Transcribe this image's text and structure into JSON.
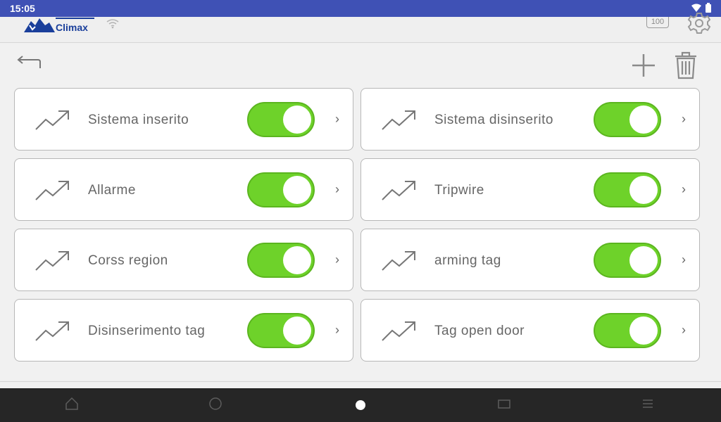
{
  "status": {
    "time": "15:05"
  },
  "app": {
    "brand": "Climax",
    "battery_label": "100"
  },
  "cards": [
    {
      "label": "Sistema inserito",
      "enabled": true
    },
    {
      "label": "Sistema disinserito",
      "enabled": true
    },
    {
      "label": "Allarme",
      "enabled": true
    },
    {
      "label": "Tripwire",
      "enabled": true
    },
    {
      "label": "Corss region",
      "enabled": true
    },
    {
      "label": "arming tag",
      "enabled": true
    },
    {
      "label": "Disinserimento tag",
      "enabled": true
    },
    {
      "label": "Tag open door",
      "enabled": true
    }
  ],
  "chevron": "›",
  "colors": {
    "statusbar": "#3f51b5",
    "toggle_on": "#6ed22a",
    "brand": "#1a3f9b"
  }
}
